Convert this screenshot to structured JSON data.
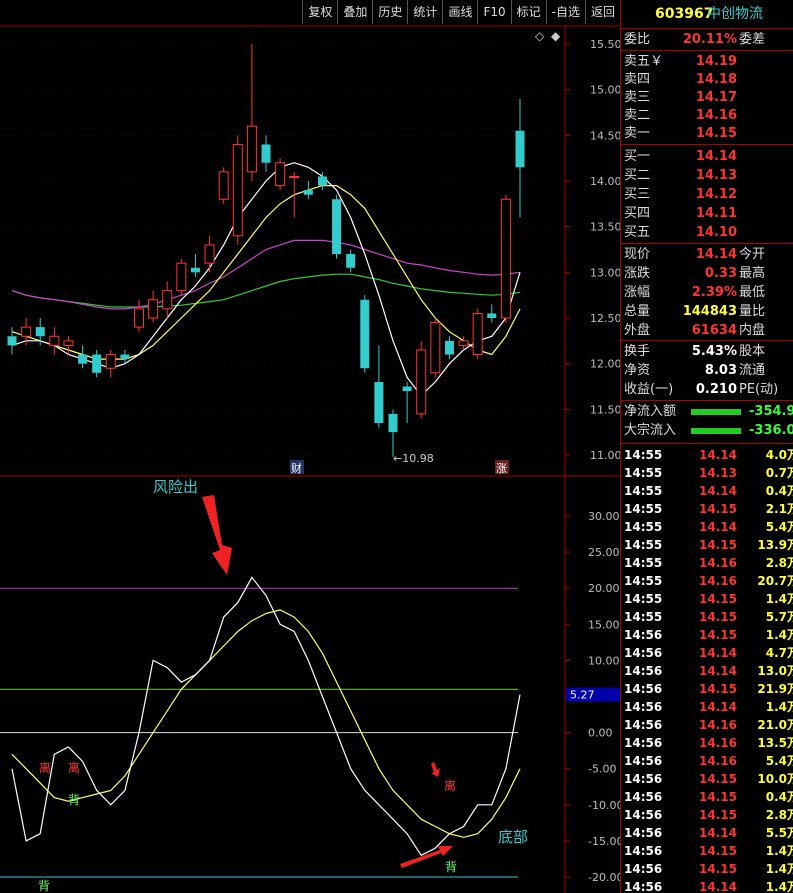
{
  "toolbar": [
    "复权",
    "叠加",
    "历史",
    "统计",
    "画线",
    "F10",
    "标记",
    "-自选",
    "返回"
  ],
  "stock": {
    "code": "603967",
    "name": "中创物流"
  },
  "colors": {
    "up": "#ff3333",
    "down": "#33cccc",
    "ma_short": "#ffffff",
    "ma_mid": "#ffff66",
    "ma_long_purple": "#cc44cc",
    "ma_long_green": "#33cc33"
  },
  "price_axis": {
    "ticks": [
      "15.50",
      "15.00",
      "14.50",
      "14.00",
      "13.50",
      "13.00",
      "12.50",
      "12.00",
      "11.50",
      "11.00"
    ]
  },
  "price_low_label": "10.98",
  "markers": {
    "cai": "财",
    "zhang": "涨"
  },
  "indicator_axis": {
    "ticks": [
      "30.00",
      "25.00",
      "20.00",
      "15.00",
      "10.00",
      "5.00",
      "0.00",
      "-5.00",
      "-10.00",
      "-15.00",
      "-20.00"
    ],
    "current": "5.27"
  },
  "annotations": {
    "risk": "风险出",
    "bottom": "底部",
    "li1": "离",
    "li2": "离",
    "li3": "离",
    "bei1": "背",
    "bei2": "背",
    "bei3": "背"
  },
  "quote": {
    "weibi_label": "委比",
    "weibi_value": "20.11%",
    "weicha_label": "委差",
    "asks": [
      {
        "label": "卖五￥",
        "price": "14.19"
      },
      {
        "label": "卖四",
        "price": "14.18"
      },
      {
        "label": "卖三",
        "price": "14.17"
      },
      {
        "label": "卖二",
        "price": "14.16"
      },
      {
        "label": "卖一",
        "price": "14.15"
      }
    ],
    "bids": [
      {
        "label": "买一",
        "price": "14.14"
      },
      {
        "label": "买二",
        "price": "14.13"
      },
      {
        "label": "买三",
        "price": "14.12"
      },
      {
        "label": "买四",
        "price": "14.11"
      },
      {
        "label": "买五",
        "price": "14.10"
      }
    ],
    "stats": [
      {
        "label": "现价",
        "value": "14.14",
        "label2": "今开",
        "color": "red"
      },
      {
        "label": "涨跌",
        "value": "0.33",
        "label2": "最高",
        "color": "red"
      },
      {
        "label": "涨幅",
        "value": "2.39%",
        "label2": "最低",
        "color": "red"
      },
      {
        "label": "总量",
        "value": "144843",
        "label2": "量比",
        "color": "yel"
      },
      {
        "label": "外盘",
        "value": "61634",
        "label2": "内盘",
        "color": "red"
      }
    ],
    "stats2": [
      {
        "label": "换手",
        "value": "5.43%",
        "label2": "股本",
        "color": "white"
      },
      {
        "label": "净资",
        "value": "8.03",
        "label2": "流通",
        "color": "white"
      },
      {
        "label": "收益(一)",
        "value": "0.210",
        "label2": "PE(动)",
        "color": "white"
      }
    ],
    "flow": [
      {
        "label": "净流入额",
        "value": "-354.9"
      },
      {
        "label": "大宗流入",
        "value": "-336.0"
      }
    ]
  },
  "ticks": [
    {
      "t": "14:55",
      "p": "14.14",
      "v": "4.0万",
      "c": "red"
    },
    {
      "t": "14:55",
      "p": "14.13",
      "v": "0.7万",
      "c": "red"
    },
    {
      "t": "14:55",
      "p": "14.14",
      "v": "0.4万",
      "c": "red"
    },
    {
      "t": "14:55",
      "p": "14.15",
      "v": "2.1万",
      "c": "red"
    },
    {
      "t": "14:55",
      "p": "14.14",
      "v": "5.4万",
      "c": "red"
    },
    {
      "t": "14:55",
      "p": "14.15",
      "v": "13.9万",
      "c": "red"
    },
    {
      "t": "14:55",
      "p": "14.16",
      "v": "2.8万",
      "c": "red"
    },
    {
      "t": "14:55",
      "p": "14.16",
      "v": "20.7万",
      "c": "red"
    },
    {
      "t": "14:55",
      "p": "14.15",
      "v": "1.4万",
      "c": "red"
    },
    {
      "t": "14:55",
      "p": "14.15",
      "v": "5.7万",
      "c": "red"
    },
    {
      "t": "14:56",
      "p": "14.15",
      "v": "1.4万",
      "c": "red"
    },
    {
      "t": "14:56",
      "p": "14.14",
      "v": "4.7万",
      "c": "red"
    },
    {
      "t": "14:56",
      "p": "14.14",
      "v": "13.0万",
      "c": "red"
    },
    {
      "t": "14:56",
      "p": "14.15",
      "v": "21.9万",
      "c": "red"
    },
    {
      "t": "14:56",
      "p": "14.14",
      "v": "1.4万",
      "c": "red"
    },
    {
      "t": "14:56",
      "p": "14.16",
      "v": "21.0万",
      "c": "red"
    },
    {
      "t": "14:56",
      "p": "14.16",
      "v": "13.5万",
      "c": "red"
    },
    {
      "t": "14:56",
      "p": "14.16",
      "v": "5.4万",
      "c": "red"
    },
    {
      "t": "14:56",
      "p": "14.15",
      "v": "10.0万",
      "c": "red"
    },
    {
      "t": "14:56",
      "p": "14.15",
      "v": "0.4万",
      "c": "red"
    },
    {
      "t": "14:56",
      "p": "14.15",
      "v": "2.8万",
      "c": "red"
    },
    {
      "t": "14:56",
      "p": "14.14",
      "v": "5.5万",
      "c": "red"
    },
    {
      "t": "14:56",
      "p": "14.15",
      "v": "1.4万",
      "c": "red"
    },
    {
      "t": "14:56",
      "p": "14.15",
      "v": "1.4万",
      "c": "red"
    },
    {
      "t": "14:56",
      "p": "14.14",
      "v": "1.4万",
      "c": "red"
    }
  ],
  "chart_data": {
    "type": "candlestick",
    "candles": [
      {
        "o": 12.3,
        "c": 12.2,
        "h": 12.4,
        "l": 12.1
      },
      {
        "o": 12.3,
        "c": 12.4,
        "h": 12.5,
        "l": 12.2
      },
      {
        "o": 12.4,
        "c": 12.3,
        "h": 12.5,
        "l": 12.2
      },
      {
        "o": 12.2,
        "c": 12.3,
        "h": 12.4,
        "l": 12.1
      },
      {
        "o": 12.2,
        "c": 12.25,
        "h": 12.3,
        "l": 12.1
      },
      {
        "o": 12.1,
        "c": 12.0,
        "h": 12.2,
        "l": 11.95
      },
      {
        "o": 12.1,
        "c": 11.9,
        "h": 12.15,
        "l": 11.85
      },
      {
        "o": 11.95,
        "c": 12.1,
        "h": 12.15,
        "l": 11.85
      },
      {
        "o": 12.1,
        "c": 12.05,
        "h": 12.15,
        "l": 12.0
      },
      {
        "o": 12.4,
        "c": 12.6,
        "h": 12.7,
        "l": 12.35
      },
      {
        "o": 12.5,
        "c": 12.7,
        "h": 12.8,
        "l": 12.45
      },
      {
        "o": 12.6,
        "c": 12.8,
        "h": 12.9,
        "l": 12.5
      },
      {
        "o": 12.8,
        "c": 13.1,
        "h": 13.15,
        "l": 12.75
      },
      {
        "o": 13.05,
        "c": 13.0,
        "h": 13.2,
        "l": 12.95
      },
      {
        "o": 13.1,
        "c": 13.3,
        "h": 13.4,
        "l": 13.0
      },
      {
        "o": 13.8,
        "c": 14.1,
        "h": 14.15,
        "l": 13.75
      },
      {
        "o": 13.4,
        "c": 14.4,
        "h": 14.5,
        "l": 13.3
      },
      {
        "o": 14.1,
        "c": 14.6,
        "h": 15.5,
        "l": 14.0
      },
      {
        "o": 14.4,
        "c": 14.2,
        "h": 14.5,
        "l": 14.1
      },
      {
        "o": 13.95,
        "c": 14.2,
        "h": 14.25,
        "l": 13.9
      },
      {
        "o": 14.05,
        "c": 14.05,
        "h": 14.1,
        "l": 13.6
      },
      {
        "o": 13.9,
        "c": 13.85,
        "h": 14.0,
        "l": 13.8
      },
      {
        "o": 14.05,
        "c": 13.95,
        "h": 14.1,
        "l": 13.9
      },
      {
        "o": 13.8,
        "c": 13.2,
        "h": 13.85,
        "l": 13.15
      },
      {
        "o": 13.2,
        "c": 13.05,
        "h": 13.25,
        "l": 13.0
      },
      {
        "o": 12.7,
        "c": 11.95,
        "h": 12.75,
        "l": 11.9
      },
      {
        "o": 11.8,
        "c": 11.35,
        "h": 12.2,
        "l": 11.3
      },
      {
        "o": 11.45,
        "c": 11.25,
        "h": 11.5,
        "l": 10.98
      },
      {
        "o": 11.75,
        "c": 11.7,
        "h": 11.8,
        "l": 11.35
      },
      {
        "o": 11.45,
        "c": 12.15,
        "h": 12.25,
        "l": 11.4
      },
      {
        "o": 11.9,
        "c": 12.45,
        "h": 12.5,
        "l": 11.85
      },
      {
        "o": 12.25,
        "c": 12.1,
        "h": 12.3,
        "l": 12.05
      },
      {
        "o": 12.2,
        "c": 12.25,
        "h": 12.3,
        "l": 12.15
      },
      {
        "o": 12.1,
        "c": 12.55,
        "h": 12.6,
        "l": 12.05
      },
      {
        "o": 12.55,
        "c": 12.5,
        "h": 12.65,
        "l": 12.45
      },
      {
        "o": 12.5,
        "c": 13.8,
        "h": 13.85,
        "l": 12.45
      },
      {
        "o": 14.55,
        "c": 14.15,
        "h": 14.9,
        "l": 13.6
      }
    ],
    "ma_short": [
      12.2,
      12.25,
      12.25,
      12.2,
      12.1,
      12.05,
      12.0,
      11.95,
      12.0,
      12.1,
      12.3,
      12.5,
      12.7,
      12.85,
      13.05,
      13.3,
      13.6,
      13.8,
      14.0,
      14.15,
      14.2,
      14.15,
      14.05,
      13.9,
      13.6,
      13.2,
      12.75,
      12.25,
      11.85,
      11.65,
      11.8,
      12.0,
      12.15,
      12.25,
      12.3,
      12.5,
      13.0
    ],
    "ma_mid": [
      12.35,
      12.3,
      12.25,
      12.2,
      12.15,
      12.1,
      12.05,
      12.05,
      12.05,
      12.1,
      12.2,
      12.35,
      12.5,
      12.65,
      12.8,
      13.0,
      13.2,
      13.4,
      13.6,
      13.75,
      13.85,
      13.9,
      13.95,
      13.95,
      13.85,
      13.7,
      13.45,
      13.2,
      12.95,
      12.7,
      12.5,
      12.35,
      12.25,
      12.15,
      12.1,
      12.3,
      12.6
    ],
    "ma_purple": [
      12.8,
      12.75,
      12.72,
      12.7,
      12.68,
      12.65,
      12.62,
      12.6,
      12.6,
      12.62,
      12.65,
      12.7,
      12.75,
      12.8,
      12.88,
      12.95,
      13.05,
      13.15,
      13.25,
      13.3,
      13.35,
      13.35,
      13.35,
      13.33,
      13.3,
      13.25,
      13.2,
      13.15,
      13.1,
      13.08,
      13.05,
      13.02,
      13.0,
      12.98,
      12.97,
      12.98,
      13.0
    ],
    "ma_green": [
      12.8,
      12.75,
      12.72,
      12.7,
      12.68,
      12.66,
      12.64,
      12.62,
      12.62,
      12.62,
      12.62,
      12.63,
      12.64,
      12.66,
      12.68,
      12.7,
      12.75,
      12.8,
      12.85,
      12.9,
      12.93,
      12.95,
      12.97,
      12.98,
      12.98,
      12.95,
      12.92,
      12.88,
      12.85,
      12.82,
      12.8,
      12.78,
      12.77,
      12.76,
      12.75,
      12.76,
      12.78
    ],
    "indicator_fast": [
      -5,
      -15,
      -14,
      -3,
      -2,
      -4,
      -8,
      -10,
      -8,
      0,
      10,
      9,
      7,
      8,
      10,
      16,
      18,
      21.5,
      19,
      15,
      14,
      10,
      5,
      0,
      -5,
      -8,
      -10,
      -12,
      -14,
      -17,
      -16,
      -14,
      -13,
      -10,
      -10,
      -5,
      5.27
    ],
    "indicator_slow": [
      -3,
      -5,
      -7,
      -9,
      -9.5,
      -9,
      -8.5,
      -8,
      -6,
      -3,
      0,
      3,
      6,
      8,
      10,
      12,
      14,
      15.5,
      16.5,
      17,
      16,
      14,
      11,
      7,
      3,
      -1,
      -5,
      -8,
      -10,
      -12,
      -13,
      -14,
      -14.5,
      -14,
      -12,
      -9,
      -5
    ]
  }
}
